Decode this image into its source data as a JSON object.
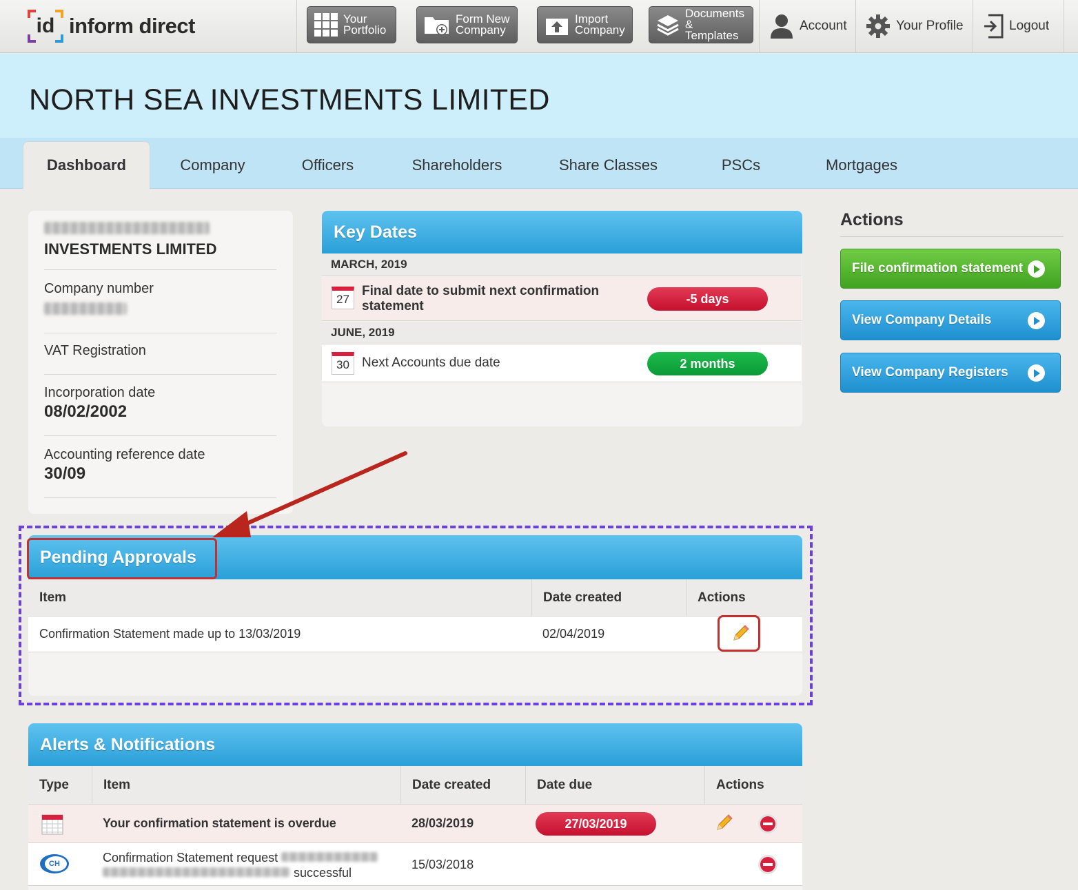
{
  "brand": {
    "logo_mark": "id",
    "logo_text": "inform direct"
  },
  "topnav": {
    "buttons": [
      {
        "label": "Your\nPortfolio",
        "icon": "grid-icon"
      },
      {
        "label": "Form New\nCompany",
        "icon": "folder-add-icon"
      },
      {
        "label": "Import\nCompany",
        "icon": "upload-icon"
      },
      {
        "label": "Documents\n& Templates",
        "icon": "layers-icon"
      }
    ],
    "links": [
      {
        "label": "Account",
        "icon": "user-icon"
      },
      {
        "label": "Your Profile",
        "icon": "gear-icon"
      },
      {
        "label": "Logout",
        "icon": "logout-icon"
      }
    ]
  },
  "company": {
    "title": "NORTH SEA INVESTMENTS LIMITED"
  },
  "tabs": [
    "Dashboard",
    "Company",
    "Officers",
    "Shareholders",
    "Share Classes",
    "PSCs",
    "Mortgages"
  ],
  "summary": {
    "name_line2": "INVESTMENTS LIMITED",
    "company_number_label": "Company number",
    "vat_label": "VAT Registration",
    "incorporation_label": "Incorporation date",
    "incorporation_value": "08/02/2002",
    "ard_label": "Accounting reference date",
    "ard_value": "30/09"
  },
  "key_dates": {
    "title": "Key Dates",
    "groups": [
      {
        "month": "MARCH, 2019",
        "day": "27",
        "text": "Final date to submit next confirmation statement",
        "badge": "-5 days",
        "status": "overdue"
      },
      {
        "month": "JUNE, 2019",
        "day": "30",
        "text": "Next Accounts due date",
        "badge": "2 months",
        "status": "ok"
      }
    ]
  },
  "actions": {
    "title": "Actions",
    "buttons": [
      "File confirmation statement",
      "View Company Details",
      "View Company Registers"
    ]
  },
  "pending": {
    "title": "Pending Approvals",
    "columns": [
      "Item",
      "Date created",
      "Actions"
    ],
    "rows": [
      {
        "item": "Confirmation Statement made up to 13/03/2019",
        "date": "02/04/2019"
      }
    ]
  },
  "alerts": {
    "title": "Alerts & Notifications",
    "columns": [
      "Type",
      "Item",
      "Date created",
      "Date due",
      "Actions"
    ],
    "rows": [
      {
        "item": "Your confirmation statement is overdue",
        "date_created": "28/03/2019",
        "date_due": "27/03/2019"
      },
      {
        "item_prefix": "Confirmation Statement request",
        "item_suffix": "successful",
        "date_created": "15/03/2018",
        "badge_icon_text": "CH"
      }
    ]
  },
  "colors": {
    "accent_blue": "#2a9fd8",
    "header_bg": "#cdeefb",
    "danger": "#c5102e",
    "success": "#0a9a35",
    "highlight_dash": "#6b40e0",
    "highlight_box": "#c43030"
  }
}
